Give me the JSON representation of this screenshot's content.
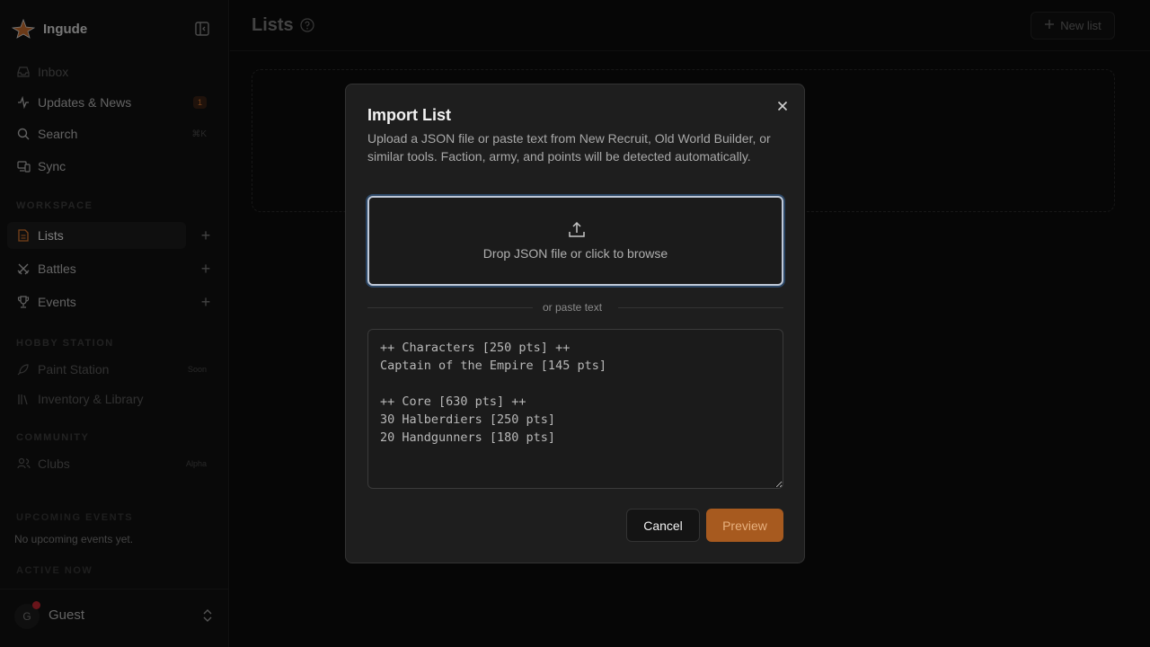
{
  "brand": {
    "name": "Ingude"
  },
  "sidebar": {
    "nav": [
      {
        "label": "Inbox",
        "icon": "inbox-icon"
      },
      {
        "label": "Updates & News",
        "icon": "activity-icon",
        "badge": "1"
      },
      {
        "label": "Search",
        "icon": "search-icon",
        "shortcut": "⌘K"
      },
      {
        "label": "Sync",
        "icon": "devices-icon"
      }
    ],
    "workspace_title": "WORKSPACE",
    "workspace": [
      {
        "label": "Lists",
        "icon": "list-doc-icon"
      },
      {
        "label": "Battles",
        "icon": "swords-icon"
      },
      {
        "label": "Events",
        "icon": "trophy-icon"
      }
    ],
    "hobby_title": "HOBBY STATION",
    "hobby": [
      {
        "label": "Paint Station",
        "icon": "rocket-icon",
        "tag": "Soon"
      },
      {
        "label": "Inventory & Library",
        "icon": "library-icon"
      }
    ],
    "community_title": "COMMUNITY",
    "community": [
      {
        "label": "Clubs",
        "icon": "users-icon",
        "tag": "Alpha"
      }
    ],
    "upcoming_title": "UPCOMING EVENTS",
    "upcoming_empty": "No upcoming events yet.",
    "active_title": "ACTIVE NOW"
  },
  "user": {
    "initial": "G",
    "name": "Guest"
  },
  "header": {
    "title": "Lists",
    "new_list_label": "New list"
  },
  "modal": {
    "title": "Import List",
    "description": "Upload a JSON file or paste text from New Recruit, Old World Builder, or similar tools. Faction, army, and points will be detected automatically.",
    "drop_text": "Drop JSON file or click to browse",
    "divider_text": "or paste text",
    "paste_value": "++ Characters [250 pts] ++\nCaptain of the Empire [145 pts]\n\n++ Core [630 pts] ++\n30 Halberdiers [250 pts]\n20 Handgunners [180 pts]",
    "cancel_label": "Cancel",
    "preview_label": "Preview"
  },
  "colors": {
    "accent": "#a75a1f",
    "badge": "#d9772f",
    "focus_ring": "#bfc8d6"
  }
}
